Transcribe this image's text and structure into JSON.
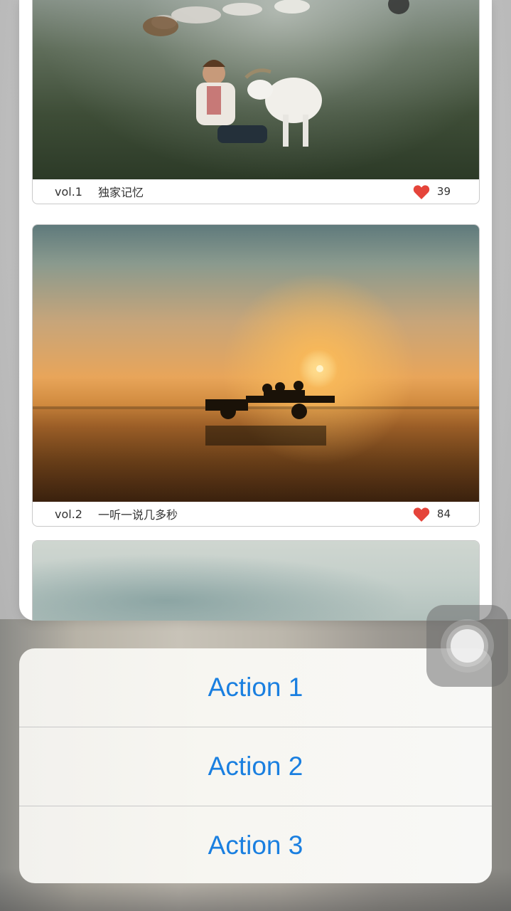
{
  "list": {
    "items": [
      {
        "vol": "vol.1",
        "title": "独家记忆",
        "likes": "39"
      },
      {
        "vol": "vol.2",
        "title": "一听一说几多秒",
        "likes": "84"
      }
    ]
  },
  "action_sheet": {
    "actions": [
      "Action 1",
      "Action 2",
      "Action 3"
    ]
  },
  "colors": {
    "action_text": "#1a7fe0",
    "heart": "#e5443a"
  },
  "icons": {
    "like": "heart-icon",
    "assistive_touch": "assistive-touch-icon"
  }
}
